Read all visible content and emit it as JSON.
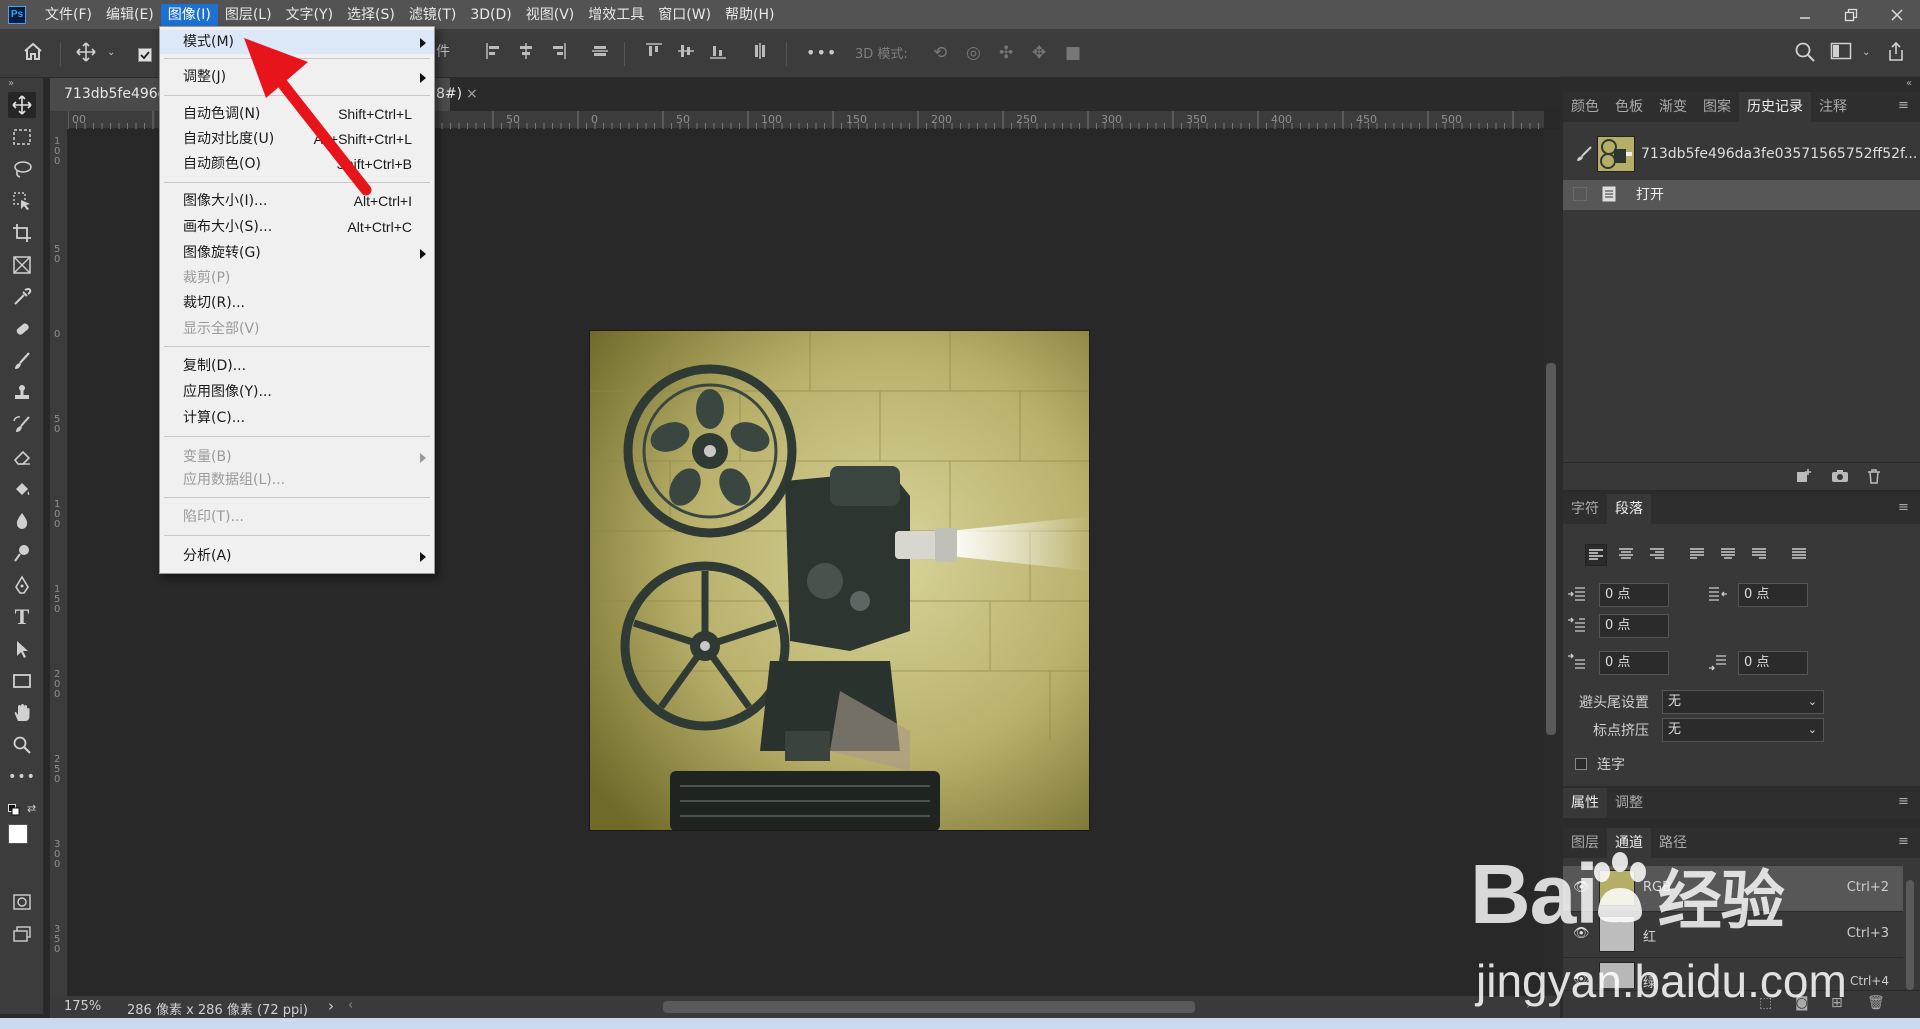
{
  "app": {
    "logo": "Ps",
    "menus": [
      "文件(F)",
      "编辑(E)",
      "图像(I)",
      "图层(L)",
      "文字(Y)",
      "选择(S)",
      "滤镜(T)",
      "3D(D)",
      "视图(V)",
      "增效工具",
      "窗口(W)",
      "帮助(H)"
    ],
    "active_menu_index": 2,
    "window_controls": [
      "minimize-icon",
      "restore-icon",
      "close-icon"
    ]
  },
  "options_bar": {
    "mode_3d_label": "3D 模式:",
    "partial_button_text": "件"
  },
  "document": {
    "tab_title": "713db5fe496d",
    "tab_suffix": "8#)",
    "tab_close": "×",
    "ruler_h_labels": [
      "00",
      "50",
      "0",
      "50",
      "100",
      "150",
      "200",
      "250",
      "300",
      "350",
      "400",
      "450",
      "500"
    ],
    "ruler_v_labels": [
      "100",
      "50",
      "0",
      "50",
      "100",
      "150",
      "200",
      "250",
      "300",
      "350"
    ],
    "zoom": "175%",
    "doc_info": "286 像素 x 286 像素 (72 ppi)",
    "status_arrow": "›"
  },
  "image_menu": {
    "items": [
      {
        "label": "模式(M)",
        "submenu": true
      },
      {
        "separator": true
      },
      {
        "label": "调整(J)",
        "submenu": true
      },
      {
        "separator": true
      },
      {
        "label": "自动色调(N)",
        "shortcut": "Shift+Ctrl+L"
      },
      {
        "label": "自动对比度(U)",
        "shortcut": "Alt+Shift+Ctrl+L"
      },
      {
        "label": "自动颜色(O)",
        "shortcut": "Shift+Ctrl+B"
      },
      {
        "separator": true
      },
      {
        "label": "图像大小(I)...",
        "shortcut": "Alt+Ctrl+I"
      },
      {
        "label": "画布大小(S)...",
        "shortcut": "Alt+Ctrl+C"
      },
      {
        "label": "图像旋转(G)",
        "submenu": true
      },
      {
        "label": "裁剪(P)",
        "disabled": true
      },
      {
        "label": "裁切(R)..."
      },
      {
        "label": "显示全部(V)",
        "disabled": true
      },
      {
        "separator": true
      },
      {
        "label": "复制(D)..."
      },
      {
        "label": "应用图像(Y)..."
      },
      {
        "label": "计算(C)..."
      },
      {
        "separator": true
      },
      {
        "label": "变量(B)",
        "submenu": true,
        "disabled": true
      },
      {
        "label": "应用数据组(L)...",
        "disabled": true
      },
      {
        "separator": true
      },
      {
        "label": "陷印(T)...",
        "disabled": true
      },
      {
        "separator": true
      },
      {
        "label": "分析(A)",
        "submenu": true
      }
    ]
  },
  "history_panel": {
    "tabs": [
      "颜色",
      "色板",
      "渐变",
      "图案",
      "历史记录",
      "注释"
    ],
    "active_tab": 4,
    "snapshot_name": "713db5fe496da3fe03571565752ff52f...",
    "steps": [
      "打开"
    ]
  },
  "paragraph_panel": {
    "tabs": [
      "字符",
      "段落"
    ],
    "active_tab": 1,
    "left_indent": "0 点",
    "right_indent": "0 点",
    "first_line_indent": "0 点",
    "space_before": "0 点",
    "space_after": "0 点",
    "kinsoku_label": "避头尾设置",
    "kinsoku_value": "无",
    "mojikumi_label": "标点挤压",
    "mojikumi_value": "无",
    "hyphenate_label": "连字"
  },
  "properties_panel": {
    "tabs": [
      "属性",
      "调整"
    ],
    "active_tab": 0
  },
  "layers_panel": {
    "tabs": [
      "图层",
      "通道",
      "路径"
    ],
    "active_tab": 1,
    "channels": [
      {
        "name": "RGB",
        "shortcut": "Ctrl+2"
      },
      {
        "name": "红",
        "shortcut": "Ctrl+3"
      },
      {
        "name": "绿",
        "shortcut": "Ctrl+4"
      }
    ]
  },
  "watermark": {
    "brand": "Bai",
    "brand_cn": "经验",
    "url": "jingyan.baidu.com"
  },
  "colors": {
    "accent": "#1c71d3",
    "arrow": "#e8141b"
  }
}
